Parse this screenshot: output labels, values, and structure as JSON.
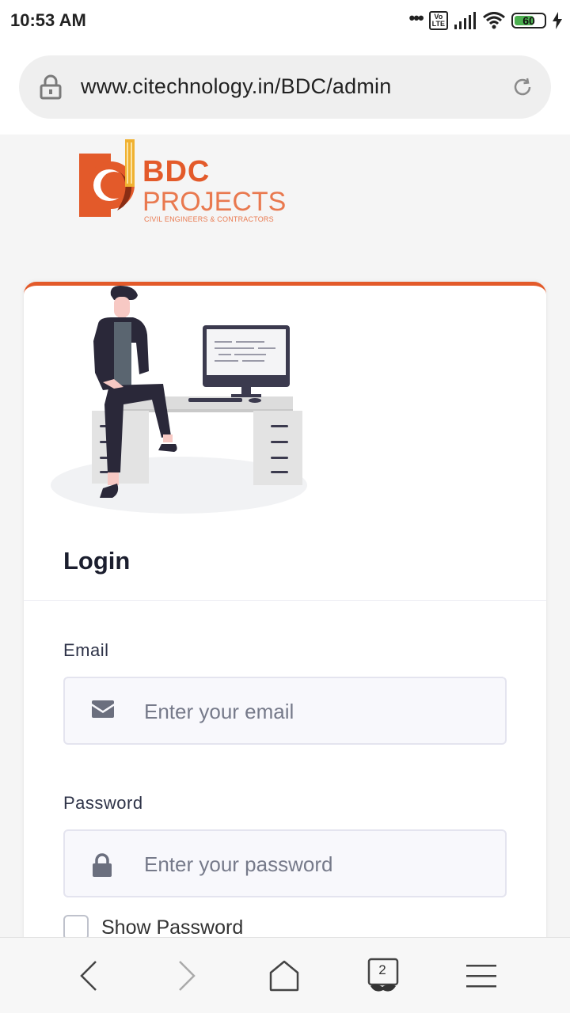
{
  "status_bar": {
    "time": "10:53 AM",
    "network_badge": "Vo\nLTE",
    "battery_level": "60",
    "icons": [
      "more-dots-icon",
      "volte-icon",
      "signal-icon",
      "wifi-icon",
      "battery-icon",
      "charging-icon"
    ]
  },
  "browser": {
    "url": "www.citechnology.in/BDC/admin",
    "icons": [
      "lock-icon",
      "reload-icon"
    ]
  },
  "logo": {
    "brand": "BDC",
    "name": "PROJECTS",
    "tagline": "CIVIL ENGINEERS & CONTRACTORS",
    "colors": {
      "primary": "#e35a2a",
      "secondary": "#e9794f",
      "accent": "#f0b131"
    }
  },
  "login": {
    "title": "Login",
    "email": {
      "label": "Email",
      "placeholder": "Enter your email",
      "value": "",
      "icon": "envelope-icon"
    },
    "password": {
      "label": "Password",
      "placeholder": "Enter your password",
      "value": "",
      "icon": "lock-icon"
    },
    "show_password": {
      "label": "Show Password",
      "checked": false
    }
  },
  "bottom_nav": {
    "tab_count": "2",
    "icons": [
      "back-icon",
      "forward-icon",
      "home-icon",
      "tabs-icon",
      "menu-icon"
    ]
  },
  "theme": {
    "accent": "#e35a2a",
    "card_bg": "#ffffff",
    "page_bg": "#f5f5f5"
  }
}
